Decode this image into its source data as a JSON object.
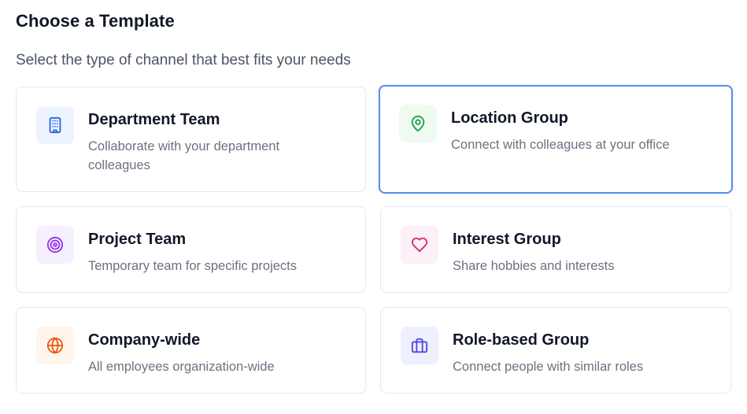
{
  "header": {
    "title": "Choose a Template",
    "subtitle": "Select the type of channel that best fits your needs"
  },
  "templates": [
    {
      "title": "Department Team",
      "description": "Collaborate with your department colleagues",
      "icon": "building-icon",
      "icon_color": "#2563eb",
      "icon_bg": "#eef4ff",
      "selected": false
    },
    {
      "title": "Location Group",
      "description": "Connect with colleagues at your office",
      "icon": "map-pin-icon",
      "icon_color": "#16a34a",
      "icon_bg": "#effaf1",
      "selected": true
    },
    {
      "title": "Project Team",
      "description": "Temporary team for specific projects",
      "icon": "target-icon",
      "icon_color": "#9333ea",
      "icon_bg": "#f6f0fe",
      "selected": false
    },
    {
      "title": "Interest Group",
      "description": "Share hobbies and interests",
      "icon": "heart-icon",
      "icon_color": "#db2777",
      "icon_bg": "#fdf0f6",
      "selected": false
    },
    {
      "title": "Company-wide",
      "description": "All employees organization-wide",
      "icon": "globe-icon",
      "icon_color": "#ea580c",
      "icon_bg": "#fff5ec",
      "selected": false
    },
    {
      "title": "Role-based Group",
      "description": "Connect people with similar roles",
      "icon": "briefcase-icon",
      "icon_color": "#4f46e5",
      "icon_bg": "#eff0fe",
      "selected": false
    }
  ],
  "colors": {
    "selected_border": "#5b8def",
    "card_border": "#e5e7eb"
  }
}
